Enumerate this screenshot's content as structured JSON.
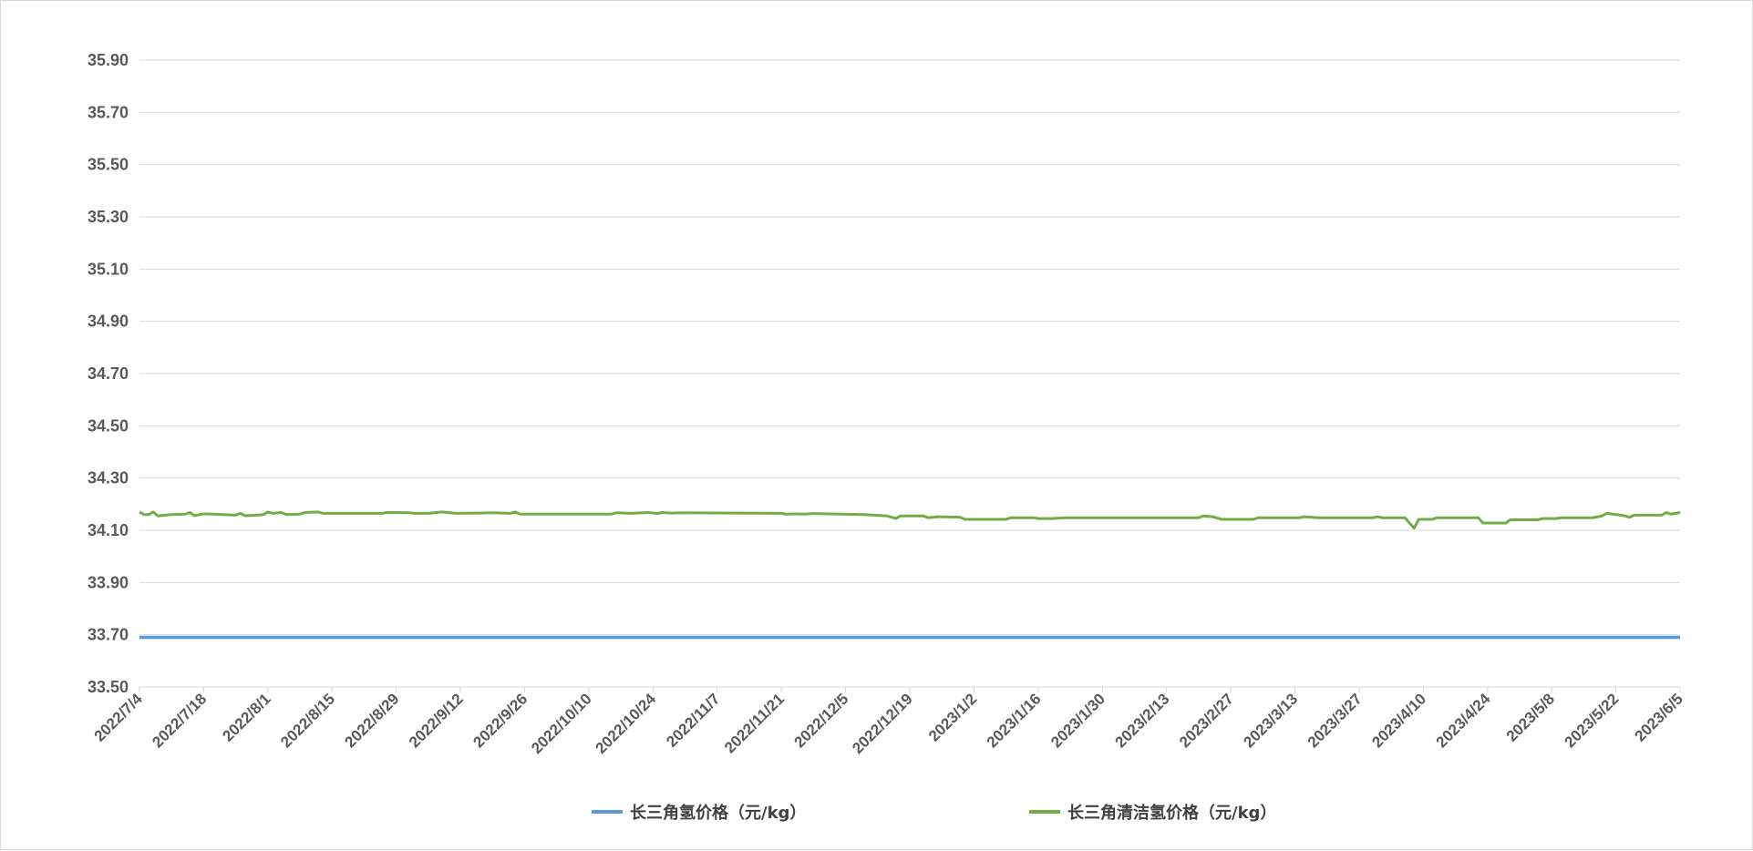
{
  "chart_data": {
    "type": "line",
    "title": "",
    "xlabel": "",
    "ylabel": "",
    "ylim": [
      33.5,
      35.9
    ],
    "y_ticks": [
      "33.50",
      "33.70",
      "33.90",
      "34.10",
      "34.30",
      "34.50",
      "34.70",
      "34.90",
      "35.10",
      "35.30",
      "35.50",
      "35.70",
      "35.90"
    ],
    "x_start": "2022-07-04",
    "x_end": "2023-06-05",
    "x_tick_labels": [
      "2022/7/4",
      "2022/7/18",
      "2022/8/1",
      "2022/8/15",
      "2022/8/29",
      "2022/9/12",
      "2022/9/26",
      "2022/10/10",
      "2022/10/24",
      "2022/11/7",
      "2022/11/21",
      "2022/12/5",
      "2022/12/19",
      "2023/1/2",
      "2023/1/16",
      "2023/1/30",
      "2023/2/13",
      "2023/2/27",
      "2023/3/13",
      "2023/3/27",
      "2023/4/10",
      "2023/4/24",
      "2023/5/8",
      "2023/5/22",
      "2023/6/5"
    ],
    "grid": true,
    "legend_position": "bottom",
    "series": [
      {
        "name": "长三角氢价格（元/kg）",
        "color": "#5b9bd5",
        "points": [
          [
            "2022-07-04",
            33.69
          ],
          [
            "2023-06-05",
            33.69
          ]
        ]
      },
      {
        "name": "长三角清洁氢价格（元/kg）",
        "color": "#70ad47",
        "points": [
          [
            "2022-07-04",
            34.17
          ],
          [
            "2022-07-05",
            34.16
          ],
          [
            "2022-07-06",
            34.16
          ],
          [
            "2022-07-07",
            34.17
          ],
          [
            "2022-07-08",
            34.155
          ],
          [
            "2022-07-11",
            34.16
          ],
          [
            "2022-07-14",
            34.162
          ],
          [
            "2022-07-15",
            34.168
          ],
          [
            "2022-07-16",
            34.156
          ],
          [
            "2022-07-18",
            34.163
          ],
          [
            "2022-07-20",
            34.162
          ],
          [
            "2022-07-22",
            34.16
          ],
          [
            "2022-07-25",
            34.158
          ],
          [
            "2022-07-26",
            34.165
          ],
          [
            "2022-07-27",
            34.156
          ],
          [
            "2022-07-29",
            34.157
          ],
          [
            "2022-07-31",
            34.16
          ],
          [
            "2022-08-01",
            34.17
          ],
          [
            "2022-08-02",
            34.165
          ],
          [
            "2022-08-04",
            34.168
          ],
          [
            "2022-08-05",
            34.16
          ],
          [
            "2022-08-08",
            34.162
          ],
          [
            "2022-08-09",
            34.168
          ],
          [
            "2022-08-12",
            34.17
          ],
          [
            "2022-08-13",
            34.165
          ],
          [
            "2022-08-19",
            34.165
          ],
          [
            "2022-08-26",
            34.165
          ],
          [
            "2022-08-27",
            34.168
          ],
          [
            "2022-09-01",
            34.167
          ],
          [
            "2022-09-02",
            34.165
          ],
          [
            "2022-09-05",
            34.165
          ],
          [
            "2022-09-08",
            34.17
          ],
          [
            "2022-09-11",
            34.165
          ],
          [
            "2022-09-16",
            34.166
          ],
          [
            "2022-09-19",
            34.167
          ],
          [
            "2022-09-23",
            34.165
          ],
          [
            "2022-09-24",
            34.17
          ],
          [
            "2022-09-25",
            34.162
          ],
          [
            "2022-10-15",
            34.162
          ],
          [
            "2022-10-16",
            34.167
          ],
          [
            "2022-10-19",
            34.165
          ],
          [
            "2022-10-23",
            34.168
          ],
          [
            "2022-10-25",
            34.164
          ],
          [
            "2022-10-26",
            34.168
          ],
          [
            "2022-10-28",
            34.166
          ],
          [
            "2022-10-31",
            34.167
          ],
          [
            "2022-11-21",
            34.165
          ],
          [
            "2022-11-22",
            34.162
          ],
          [
            "2022-11-24",
            34.163
          ],
          [
            "2022-11-26",
            34.162
          ],
          [
            "2022-11-28",
            34.164
          ],
          [
            "2022-12-04",
            34.162
          ],
          [
            "2022-12-09",
            34.16
          ],
          [
            "2022-12-14",
            34.155
          ],
          [
            "2022-12-16",
            34.145
          ],
          [
            "2022-12-17",
            34.155
          ],
          [
            "2022-12-22",
            34.155
          ],
          [
            "2022-12-23",
            34.148
          ],
          [
            "2022-12-25",
            34.152
          ],
          [
            "2022-12-30",
            34.15
          ],
          [
            "2022-12-31",
            34.142
          ],
          [
            "2023-01-09",
            34.142
          ],
          [
            "2023-01-10",
            34.148
          ],
          [
            "2023-01-15",
            34.148
          ],
          [
            "2023-01-16",
            34.145
          ],
          [
            "2023-01-19",
            34.145
          ],
          [
            "2023-01-22",
            34.148
          ],
          [
            "2023-02-20",
            34.148
          ],
          [
            "2023-02-21",
            34.155
          ],
          [
            "2023-02-23",
            34.152
          ],
          [
            "2023-02-25",
            34.142
          ],
          [
            "2023-03-04",
            34.142
          ],
          [
            "2023-03-05",
            34.148
          ],
          [
            "2023-03-14",
            34.148
          ],
          [
            "2023-03-15",
            34.152
          ],
          [
            "2023-03-18",
            34.148
          ],
          [
            "2023-03-30",
            34.148
          ],
          [
            "2023-03-31",
            34.152
          ],
          [
            "2023-04-01",
            34.148
          ],
          [
            "2023-04-06",
            34.148
          ],
          [
            "2023-04-08",
            34.108
          ],
          [
            "2023-04-09",
            34.142
          ],
          [
            "2023-04-12",
            34.142
          ],
          [
            "2023-04-13",
            34.148
          ],
          [
            "2023-04-22",
            34.148
          ],
          [
            "2023-04-23",
            34.128
          ],
          [
            "2023-04-28",
            34.128
          ],
          [
            "2023-04-29",
            34.14
          ],
          [
            "2023-05-05",
            34.14
          ],
          [
            "2023-05-06",
            34.145
          ],
          [
            "2023-05-09",
            34.145
          ],
          [
            "2023-05-10",
            34.148
          ],
          [
            "2023-05-17",
            34.148
          ],
          [
            "2023-05-19",
            34.155
          ],
          [
            "2023-05-20",
            34.165
          ],
          [
            "2023-05-23",
            34.158
          ],
          [
            "2023-05-24",
            34.155
          ],
          [
            "2023-05-25",
            34.15
          ],
          [
            "2023-05-26",
            34.158
          ],
          [
            "2023-06-01",
            34.158
          ],
          [
            "2023-06-02",
            34.168
          ],
          [
            "2023-06-03",
            34.162
          ],
          [
            "2023-06-05",
            34.168
          ]
        ]
      }
    ]
  }
}
